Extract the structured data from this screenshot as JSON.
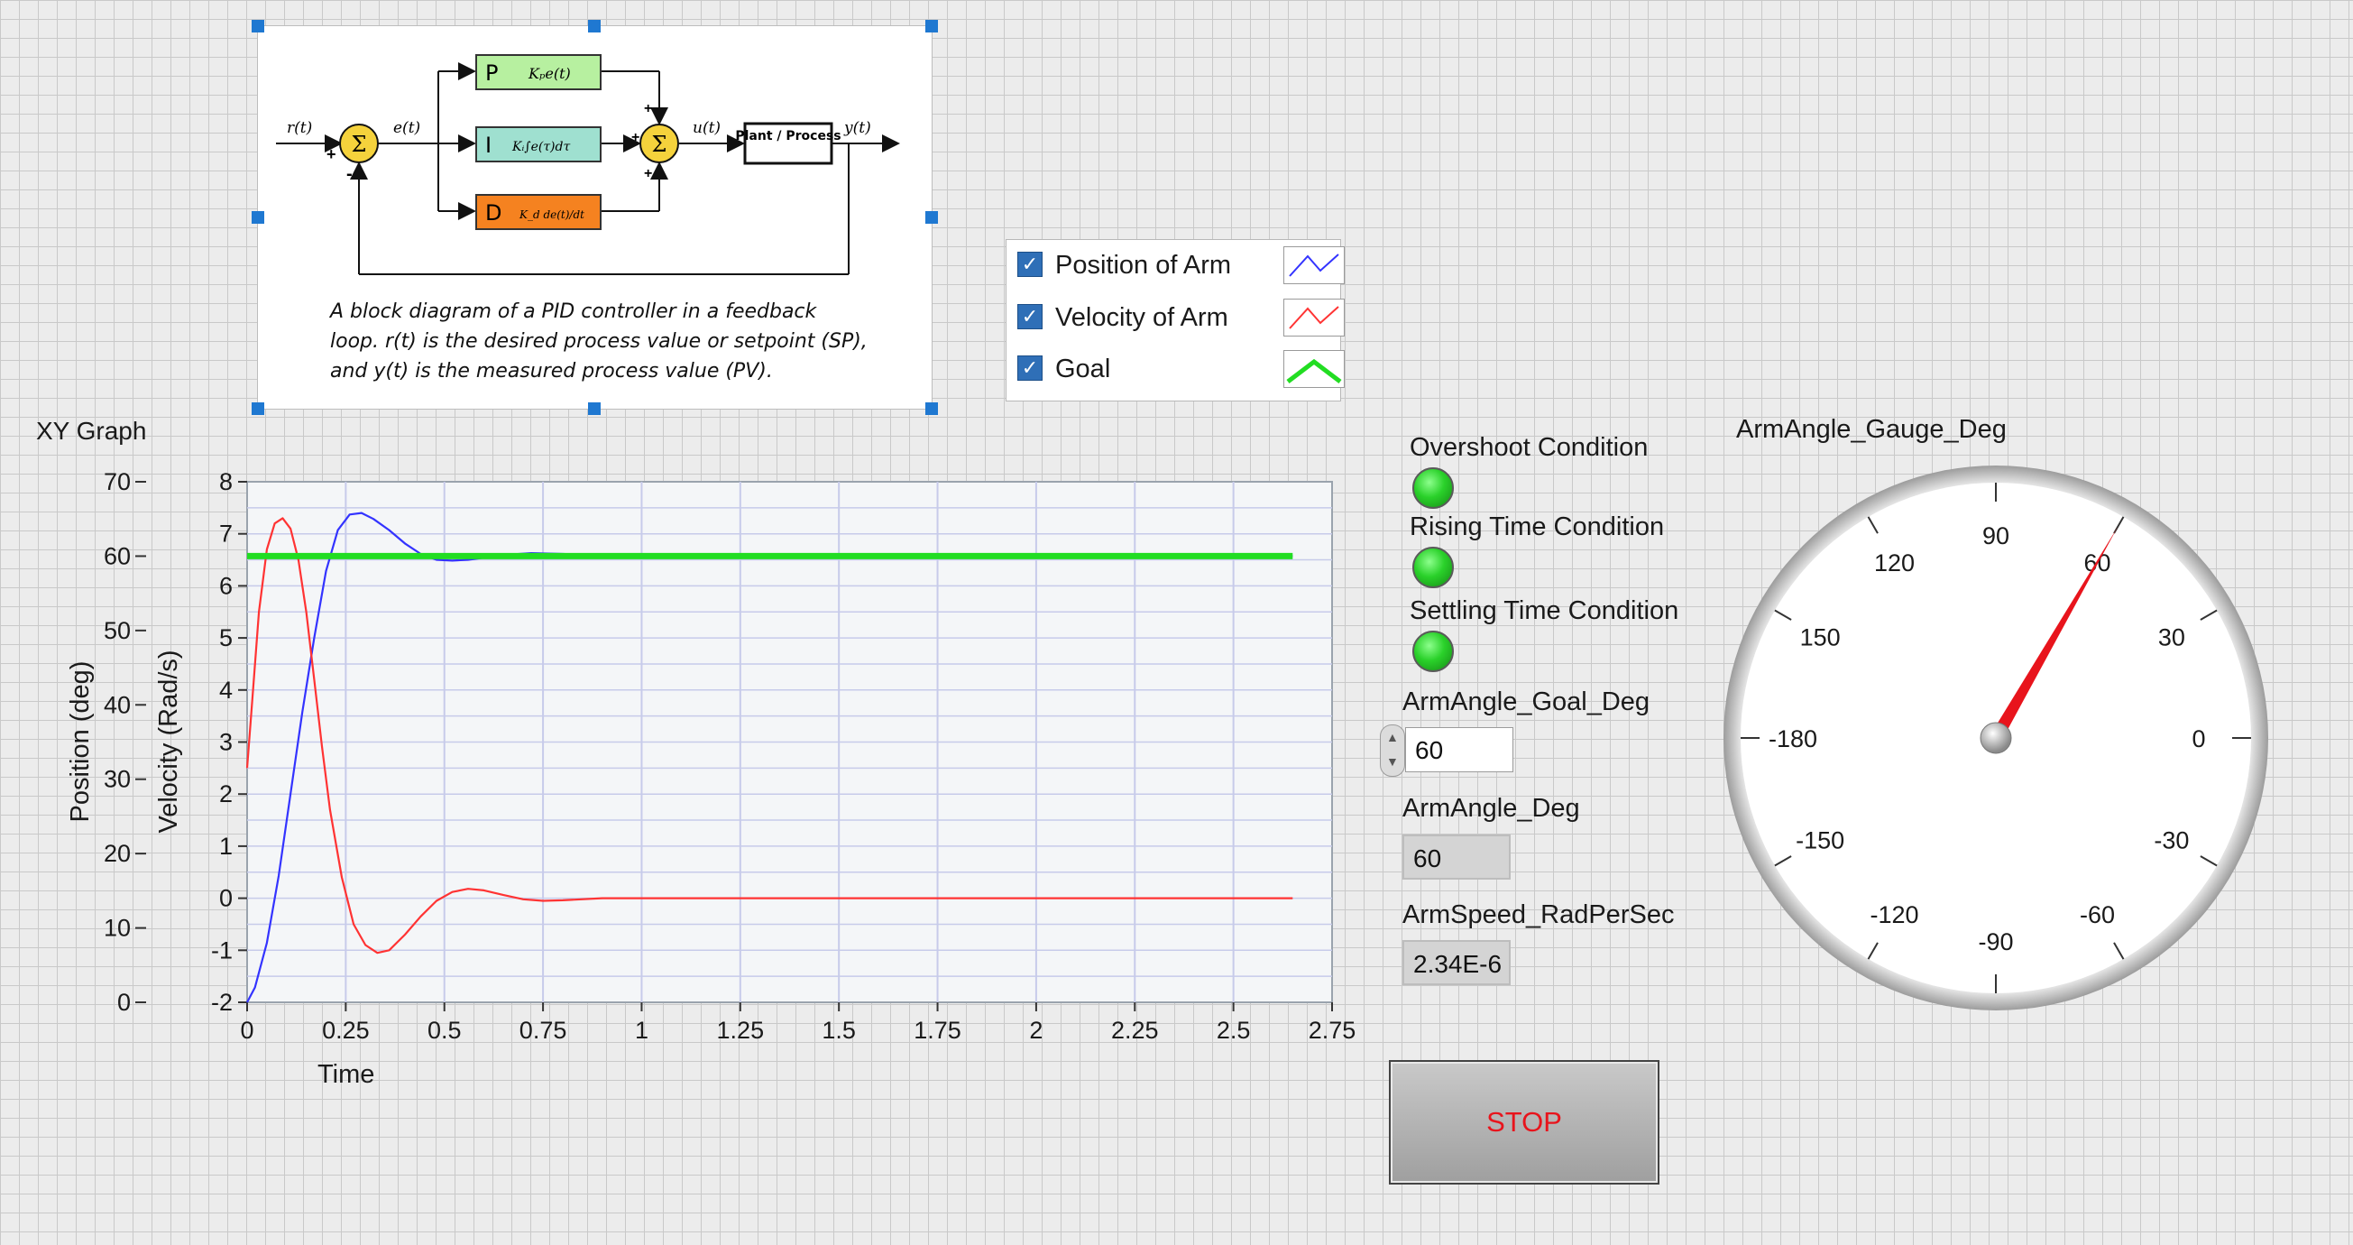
{
  "pid_diagram": {
    "caption": "A block diagram of a PID controller in a feedback loop. r(t) is the desired process value or setpoint (SP), and y(t) is the measured process value (PV).",
    "labels": {
      "r": "r(t)",
      "e": "e(t)",
      "u": "u(t)",
      "y": "y(t)",
      "p": "P",
      "i": "I",
      "d": "D",
      "p_term": "Kₚe(t)",
      "i_term": "Kᵢ∫e(τ)dτ",
      "d_term": "K_d de(t)/dt",
      "plant": "Plant / Process",
      "sum": "Σ"
    },
    "colors": {
      "p": "#b7f0a0",
      "i": "#9fe0d0",
      "d": "#f58220",
      "sum": "#f5d23c"
    }
  },
  "legend": {
    "items": [
      {
        "label": "Position of Arm",
        "checked": true,
        "color": "#3333ff"
      },
      {
        "label": "Velocity of Arm",
        "checked": true,
        "color": "#ff3333"
      },
      {
        "label": "Goal",
        "checked": true,
        "color": "#22dd22"
      }
    ]
  },
  "graph": {
    "title": "XY Graph"
  },
  "chart_data": {
    "type": "line",
    "title": "XY Graph",
    "xlabel": "Time",
    "ylabel_left": "Position (deg)",
    "ylabel_right": "Velocity (Rad/s)",
    "xlim": [
      0,
      2.75
    ],
    "ylim_position": [
      0,
      70
    ],
    "ylim_velocity": [
      -2,
      8
    ],
    "grid": true,
    "x_ticks": [
      "0",
      "0.25",
      "0.5",
      "0.75",
      "1",
      "1.25",
      "1.5",
      "1.75",
      "2",
      "2.25",
      "2.5",
      "2.75"
    ],
    "position_ticks": [
      "0",
      "10",
      "20",
      "30",
      "40",
      "50",
      "60",
      "70"
    ],
    "velocity_ticks": [
      "-2",
      "-1",
      "0",
      "1",
      "2",
      "3",
      "4",
      "5",
      "6",
      "7",
      "8"
    ],
    "series": [
      {
        "name": "Position of Arm",
        "axis": "position",
        "x": [
          0,
          0.02,
          0.05,
          0.08,
          0.11,
          0.14,
          0.17,
          0.2,
          0.23,
          0.26,
          0.29,
          0.32,
          0.36,
          0.4,
          0.44,
          0.48,
          0.52,
          0.56,
          0.6,
          0.66,
          0.72,
          0.8,
          0.9,
          1.0,
          1.2,
          1.5,
          2.0,
          2.5,
          2.65
        ],
        "y": [
          0,
          2,
          8,
          17,
          28,
          39,
          49,
          58,
          63.5,
          65.6,
          65.8,
          65,
          63.5,
          61.7,
          60.3,
          59.5,
          59.4,
          59.5,
          59.8,
          60.2,
          60.4,
          60.3,
          60.1,
          60,
          60,
          60,
          60,
          60,
          60
        ]
      },
      {
        "name": "Velocity of Arm",
        "axis": "velocity",
        "x": [
          0,
          0.01,
          0.03,
          0.05,
          0.07,
          0.09,
          0.11,
          0.13,
          0.15,
          0.17,
          0.19,
          0.21,
          0.24,
          0.27,
          0.3,
          0.33,
          0.36,
          0.4,
          0.44,
          0.48,
          0.52,
          0.56,
          0.6,
          0.65,
          0.7,
          0.75,
          0.8,
          0.9,
          1.0,
          1.5,
          2.0,
          2.5,
          2.65
        ],
        "y": [
          2.5,
          3.5,
          5.5,
          6.7,
          7.2,
          7.3,
          7.1,
          6.5,
          5.5,
          4.2,
          2.9,
          1.7,
          0.4,
          -0.5,
          -0.9,
          -1.05,
          -1.0,
          -0.7,
          -0.35,
          -0.05,
          0.12,
          0.18,
          0.15,
          0.06,
          -0.02,
          -0.05,
          -0.04,
          0,
          0,
          0,
          0,
          0,
          0
        ]
      },
      {
        "name": "Goal",
        "axis": "position",
        "x": [
          0,
          2.65
        ],
        "y": [
          60,
          60
        ]
      }
    ]
  },
  "indicators": {
    "overshoot_label": "Overshoot Condition",
    "rising_label": "Rising Time Condition",
    "settling_label": "Settling Time Condition",
    "led_color": "#2ad12a"
  },
  "controls": {
    "goal_label": "ArmAngle_Goal_Deg",
    "goal_value": "60",
    "angle_label": "ArmAngle_Deg",
    "angle_value": "60",
    "speed_label": "ArmSpeed_RadPerSec",
    "speed_value": "2.34E-6",
    "stop_label": "STOP"
  },
  "gauge": {
    "title": "ArmAngle_Gauge_Deg",
    "value": 60,
    "min": -180,
    "max": 180,
    "labels": [
      "90",
      "120",
      "60",
      "150",
      "30",
      "-180",
      "0",
      "-150",
      "-30",
      "-120",
      "-60",
      "-90"
    ],
    "needle_color": "#e8141c"
  }
}
